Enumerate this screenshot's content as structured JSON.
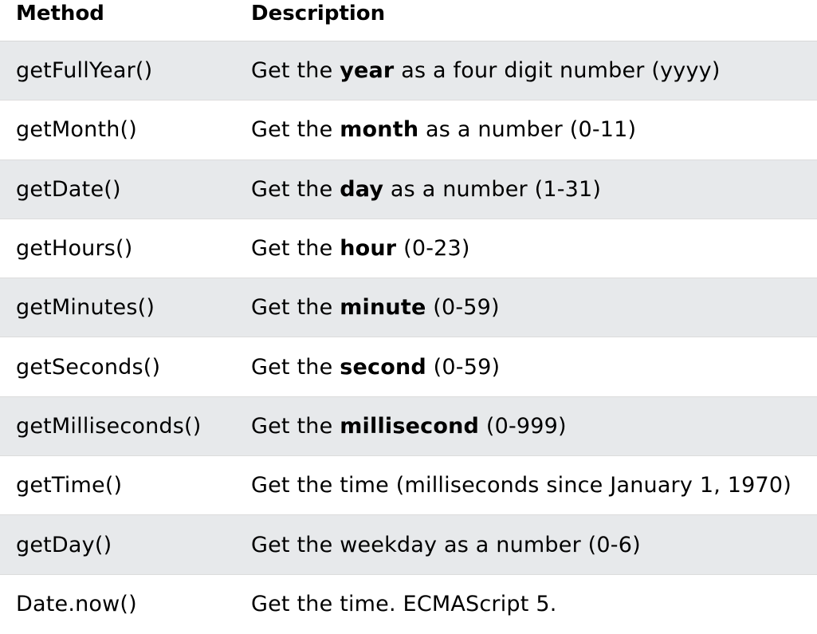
{
  "table": {
    "headers": {
      "method": "Method",
      "description": "Description"
    },
    "rows": [
      {
        "method": "getFullYear()",
        "pre": "Get the ",
        "bold": "year",
        "post": " as a four digit number (yyyy)"
      },
      {
        "method": "getMonth()",
        "pre": "Get the ",
        "bold": "month",
        "post": " as a number (0-11)"
      },
      {
        "method": "getDate()",
        "pre": "Get the ",
        "bold": "day",
        "post": " as a number (1-31)"
      },
      {
        "method": "getHours()",
        "pre": "Get the ",
        "bold": "hour",
        "post": " (0-23)"
      },
      {
        "method": "getMinutes()",
        "pre": "Get the ",
        "bold": "minute",
        "post": " (0-59)"
      },
      {
        "method": "getSeconds()",
        "pre": "Get the ",
        "bold": "second",
        "post": " (0-59)"
      },
      {
        "method": "getMilliseconds()",
        "pre": "Get the ",
        "bold": "millisecond",
        "post": " (0-999)"
      },
      {
        "method": "getTime()",
        "pre": "Get the time (milliseconds since January 1, 1970)",
        "bold": "",
        "post": ""
      },
      {
        "method": "getDay()",
        "pre": "Get the weekday as a number (0-6)",
        "bold": "",
        "post": ""
      },
      {
        "method": "Date.now()",
        "pre": "Get the time. ECMAScript 5.",
        "bold": "",
        "post": ""
      }
    ]
  },
  "colors": {
    "row_shade": "#e7e9eb",
    "row_plain": "#ffffff",
    "text": "#000000"
  }
}
